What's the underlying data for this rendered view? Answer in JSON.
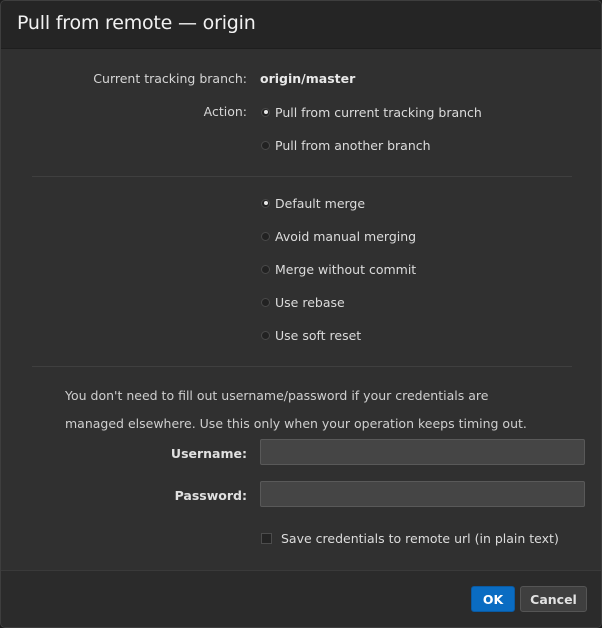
{
  "dialog": {
    "title": "Pull from remote — origin"
  },
  "tracking": {
    "label": "Current tracking branch:",
    "value": "origin/master"
  },
  "action": {
    "label": "Action:",
    "options": [
      {
        "label": "Pull from current tracking branch",
        "selected": true
      },
      {
        "label": "Pull from another branch",
        "selected": false
      }
    ]
  },
  "strategy": {
    "options": [
      {
        "label": "Default merge",
        "selected": true
      },
      {
        "label": "Avoid manual merging",
        "selected": false
      },
      {
        "label": "Merge without commit",
        "selected": false
      },
      {
        "label": "Use rebase",
        "selected": false
      },
      {
        "label": "Use soft reset",
        "selected": false
      }
    ]
  },
  "credentials": {
    "info": "You don't need to fill out username/password if your credentials are managed elsewhere. Use this only when your operation keeps timing out.",
    "username_label": "Username:",
    "username_value": "",
    "password_label": "Password:",
    "password_value": "",
    "save_label": "Save credentials to remote url (in plain text)",
    "save_checked": false
  },
  "footer": {
    "ok_label": "OK",
    "cancel_label": "Cancel"
  },
  "colors": {
    "accent": "#0a6cc2",
    "background": "#303030",
    "titlebar": "#252525"
  }
}
